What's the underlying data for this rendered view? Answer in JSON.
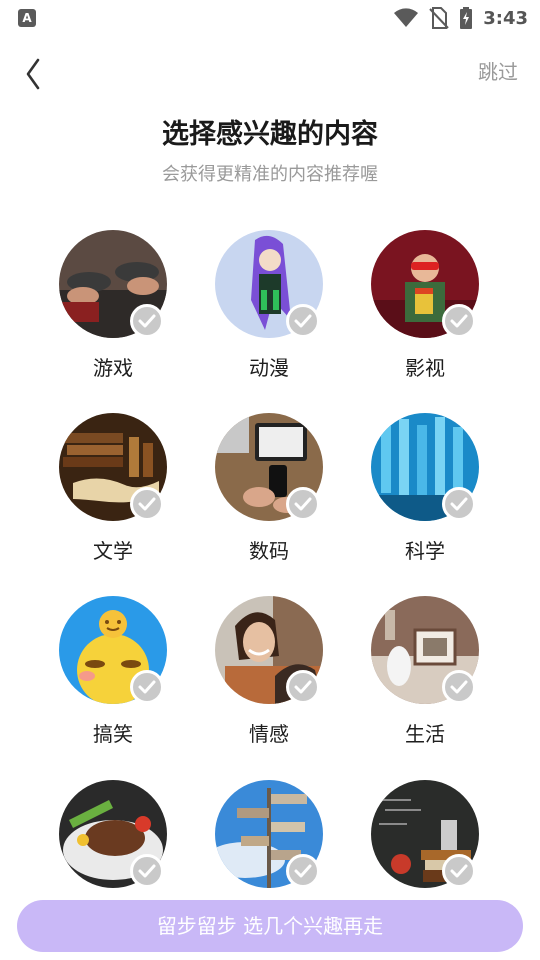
{
  "status_bar": {
    "time": "3:43",
    "app_badge": "A"
  },
  "header": {
    "skip_label": "跳过"
  },
  "heading": {
    "title": "选择感兴趣的内容",
    "subtitle": "会获得更精准的内容推荐喔"
  },
  "interests": [
    {
      "label": "游戏",
      "selected": false
    },
    {
      "label": "动漫",
      "selected": false
    },
    {
      "label": "影视",
      "selected": false
    },
    {
      "label": "文学",
      "selected": false
    },
    {
      "label": "数码",
      "selected": false
    },
    {
      "label": "科学",
      "selected": false
    },
    {
      "label": "搞笑",
      "selected": false
    },
    {
      "label": "情感",
      "selected": false
    },
    {
      "label": "生活",
      "selected": false
    },
    {
      "label": "",
      "selected": false
    },
    {
      "label": "",
      "selected": false
    },
    {
      "label": "",
      "selected": false
    }
  ],
  "footer": {
    "cta_label": "留步留步 选几个兴趣再走"
  },
  "colors": {
    "cta_bg": "#c9b8f7",
    "check_bg": "#c9c9c9",
    "muted_text": "#9a9a9a"
  }
}
